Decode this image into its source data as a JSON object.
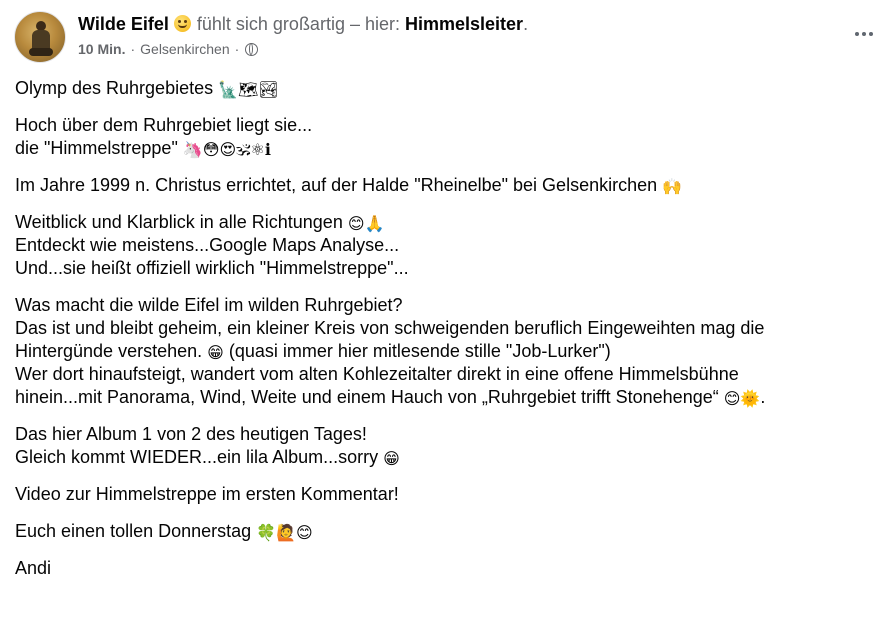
{
  "post": {
    "author": "Wilde Eifel",
    "feeling_text": "fühlt sich großartig – hier:",
    "place": "Himmelsleiter",
    "place_suffix": ".",
    "time": "10 Min.",
    "separator": "·",
    "location": "Gelsenkirchen",
    "audience_icon": "globe-icon",
    "more_icon": "more-options-icon"
  },
  "content": {
    "p1": {
      "l1": "Olymp des Ruhrgebietes",
      "l1_emojis": "🗽🗺🏞"
    },
    "p2": {
      "l1": "Hoch über dem Ruhrgebiet liegt sie...",
      "l2": "die \"Himmelstreppe\"",
      "l2_emojis": "🦄😳😍🕉⚛ℹ"
    },
    "p3": {
      "l1": "Im Jahre 1999 n. Christus errichtet, auf der Halde \"Rheinelbe\" bei Gelsenkirchen",
      "l1_emoji": "🙌"
    },
    "p4": {
      "l1": "Weitblick und Klarblick in alle Richtungen",
      "l1_emojis": "😊🙏",
      "l2": "Entdeckt wie meistens...Google Maps Analyse...",
      "l3": "Und...sie heißt offiziell wirklich \"Himmelstreppe\"..."
    },
    "p5": {
      "l1": "Was macht die wilde Eifel im wilden Ruhrgebiet?",
      "l2": "Das ist und bleibt geheim, ein kleiner Kreis von schweigenden beruflich Eingeweihten mag die",
      "l3a": "Hintergünde verstehen.",
      "l3_emoji": "😁",
      "l3b": "(quasi immer hier mitlesende stille \"Job-Lurker\")",
      "l4": "Wer dort hinaufsteigt, wandert vom alten Kohlezeitalter direkt in eine offene Himmelsbühne",
      "l5": "hinein...mit Panorama, Wind, Weite und einem Hauch von „Ruhrgebiet trifft Stonehenge“",
      "l5_emojis": "😊🌞",
      "l5_end": "."
    },
    "p6": {
      "l1": "Das hier Album 1 von 2 des heutigen Tages!",
      "l2": "Gleich kommt WIEDER...ein lila Album...sorry",
      "l2_emoji": "😁"
    },
    "p7": {
      "l1": "Video zur Himmelstreppe im ersten Kommentar!"
    },
    "p8": {
      "l1": "Euch einen tollen Donnerstag",
      "l1_emojis": "🍀🙋😊"
    },
    "p9": {
      "l1": "Andi"
    }
  }
}
